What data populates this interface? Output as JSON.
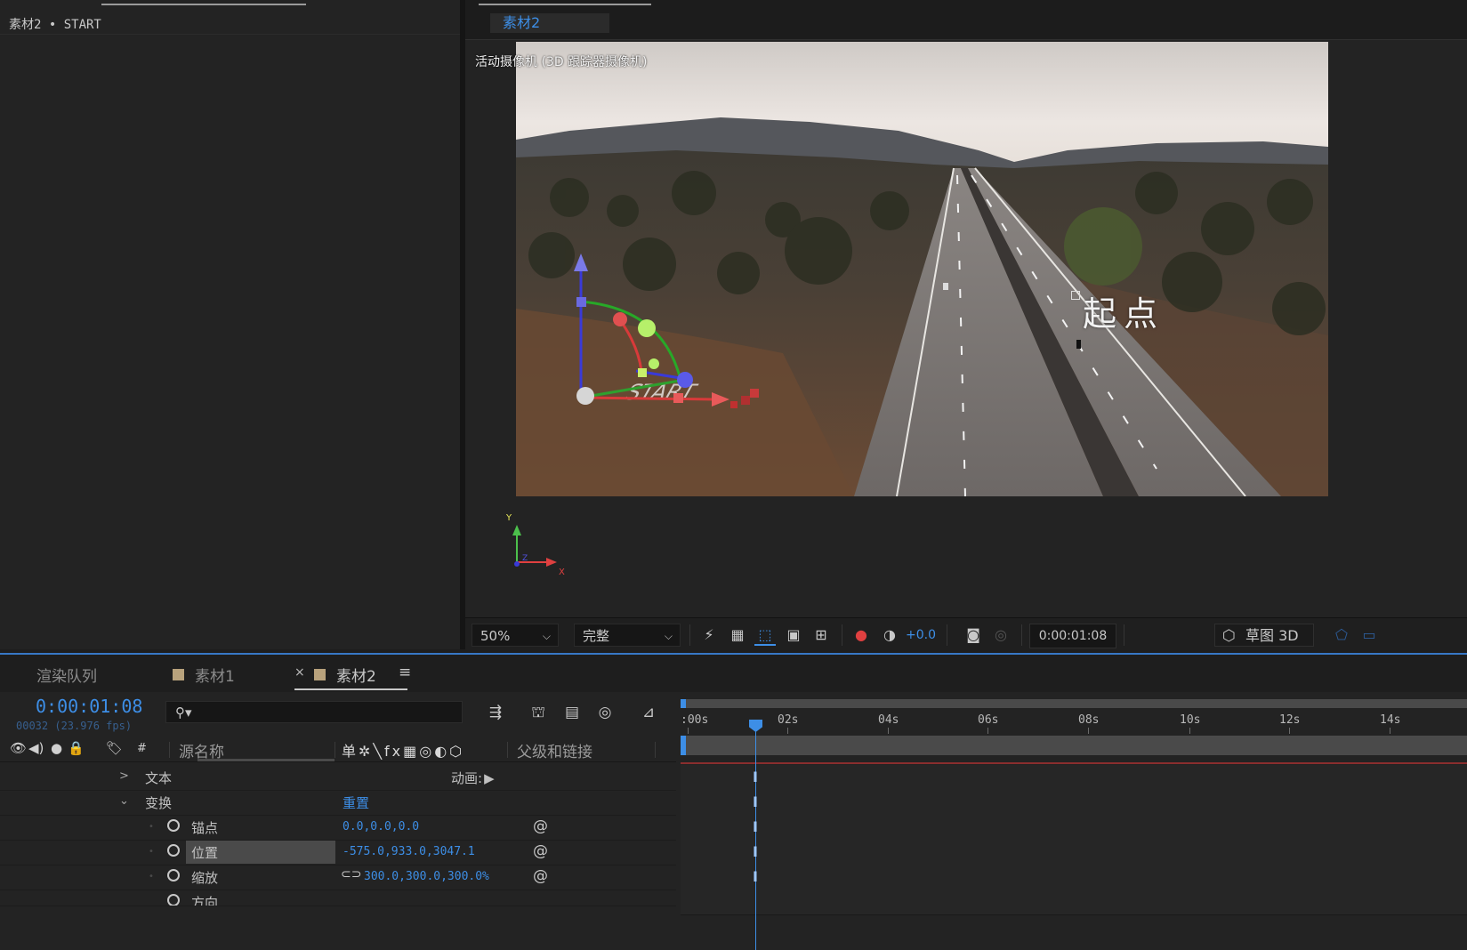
{
  "effect_controls": {
    "title": "素材2 • START"
  },
  "composition_viewer": {
    "tab_label": "素材2",
    "camera_label": "活动摄像机 (3D 跟踪器摄像机)",
    "scene_text": "起点",
    "layer_text": "START",
    "axis_labels": {
      "x": "X",
      "y": "Y",
      "z": "Z"
    },
    "toolbar": {
      "zoom": "50%",
      "resolution": "完整",
      "exposure": "+0.0",
      "timecode": "0:00:01:08",
      "renderer": "草图 3D"
    }
  },
  "timeline": {
    "tabs": [
      {
        "label": "渲染队列"
      },
      {
        "label": "素材1",
        "swatch": "#b8a27c"
      },
      {
        "label": "素材2",
        "swatch": "#b8a27c",
        "active": true
      }
    ],
    "close_glyph": "×",
    "menu_glyph": "≡",
    "current_time": "0:00:01:08",
    "frame_info": "00032 (23.976 fps)",
    "search_placeholder": "",
    "columns": {
      "hash": "#",
      "source_name": "源名称",
      "switches": "单✲╲fx▦◎◐⬡",
      "parent": "父级和链接"
    },
    "rows": {
      "text": {
        "label": "文本",
        "animate": "动画:"
      },
      "transform": {
        "label": "变换",
        "reset": "重置"
      },
      "anchor": {
        "label": "锚点",
        "value": "0.0,0.0,0.0"
      },
      "position": {
        "label": "位置",
        "value": "-575.0,933.0,3047.1"
      },
      "scale": {
        "label": "缩放",
        "value": "300.0,300.0,300.0%"
      },
      "orientation": {
        "label": "方向",
        "value": ""
      }
    },
    "ruler_labels": [
      ":00s",
      "02s",
      "04s",
      "06s",
      "08s",
      "10s",
      "12s",
      "14s"
    ]
  },
  "colors": {
    "accent": "#3d8ee6",
    "panel": "#232323",
    "label_swatch": "#b8a27c"
  }
}
